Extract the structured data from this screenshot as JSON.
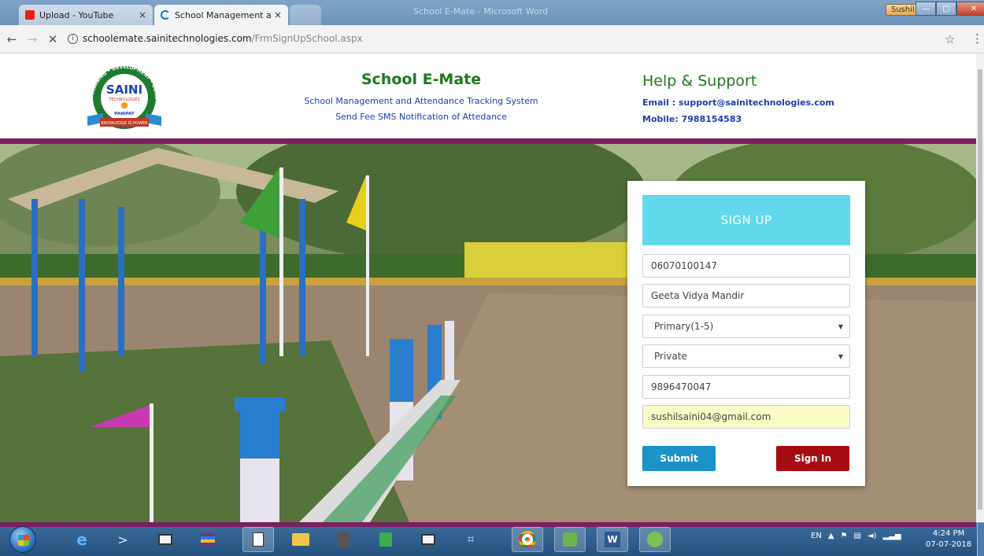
{
  "browser": {
    "tabs": [
      {
        "title": "Upload - YouTube",
        "close": "×",
        "icon": "youtube-icon"
      },
      {
        "title": "School Management and",
        "close": "×",
        "icon": "loading-spinner-icon"
      }
    ],
    "window_title": "School E-Mate - Microsoft Word",
    "user_chip": "Sushil",
    "nav": {
      "back": "←",
      "forward": "→",
      "stop": "✕"
    },
    "url_host": "schoolemate.sainitechnologies.com",
    "url_path": "/FrmSignUpSchool.aspx",
    "bookmark_icon": "☆",
    "menu_icon": "⋮",
    "window_buttons": {
      "minimize": "—",
      "maximize": "□",
      "close": "✕"
    }
  },
  "header": {
    "logo": {
      "name": "SAINI",
      "line2": "TECHNOLOGIES",
      "place": "PANIPAT",
      "arc": "TRAINING • DEVELOPMENT • CONSULTANCY",
      "motto": "KNOWLEDGE IS POWER"
    },
    "title": "School E-Mate",
    "subtitle": "School Management and Attendance Tracking System",
    "subtitle2": "Send Fee SMS Notification of Attedance",
    "help_title": "Help & Support",
    "email": "Email : support@sainitechnologies.com",
    "mobile": "Mobile: 7988154583"
  },
  "signup": {
    "heading": "SIGN UP",
    "code": "06070100147",
    "school_name": "Geeta Vidya Mandir",
    "category": "Primary(1-5)",
    "type": "Private",
    "phone": "9896470047",
    "email": "sushilsaini04@gmail.com",
    "submit_label": "Submit",
    "signin_label": "Sign In"
  },
  "colors": {
    "band": "#7c1f5e",
    "card_head": "#61d8ec",
    "submit": "#1b93c9",
    "signin": "#a50c12",
    "title_green": "#1f7a1f",
    "link_blue": "#1a3fb0"
  },
  "taskbar": {
    "apps": [
      "internet-explorer-icon",
      "powershell-icon",
      "book-icon",
      "winrar-icon",
      "notepad-icon",
      "file-explorer-icon",
      "database-icon",
      "media-icon",
      "reader-icon",
      "screen-capture-icon",
      "chrome-icon",
      "tool-icon",
      "word-icon",
      "android-studio-icon"
    ],
    "language": "EN",
    "time": "4:24 PM",
    "date": "07-07-2018"
  }
}
